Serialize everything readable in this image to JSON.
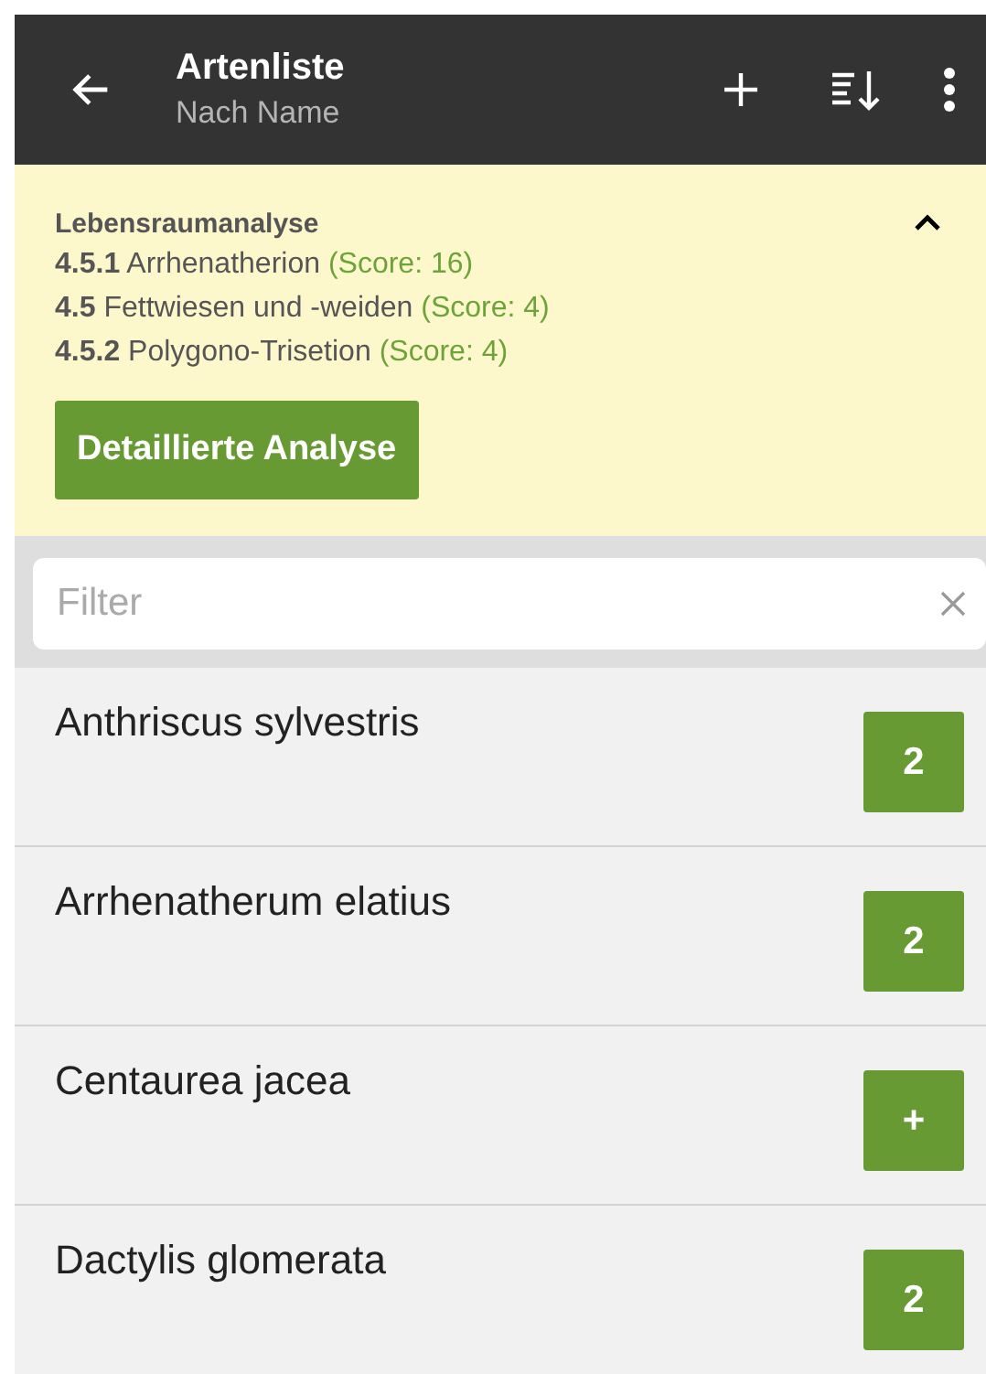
{
  "app_bar": {
    "title": "Artenliste",
    "subtitle": "Nach Name"
  },
  "analysis": {
    "title": "Lebensraumanalyse",
    "expanded": true,
    "results": [
      {
        "code": "4.5.1",
        "name": "Arrhenatherion",
        "score": "(Score: 16)"
      },
      {
        "code": "4.5",
        "name": "Fettwiesen und -weiden",
        "score": "(Score: 4)"
      },
      {
        "code": "4.5.2",
        "name": "Polygono-Trisetion",
        "score": "(Score: 4)"
      }
    ],
    "button": "Detaillierte Analyse"
  },
  "filter": {
    "placeholder": "Filter"
  },
  "species": [
    {
      "name": "Anthriscus sylvestris",
      "badge": "2"
    },
    {
      "name": "Arrhenatherum elatius",
      "badge": "2"
    },
    {
      "name": "Centaurea jacea",
      "badge": "+"
    },
    {
      "name": "Dactylis glomerata",
      "badge": "2"
    }
  ]
}
